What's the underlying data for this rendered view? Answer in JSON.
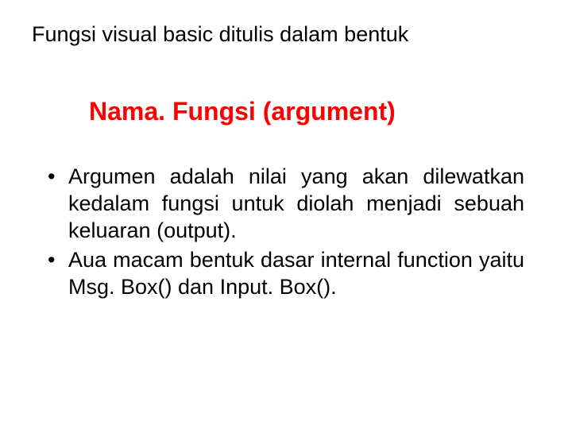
{
  "title": "Fungsi visual basic ditulis dalam bentuk",
  "syntax": "Nama. Fungsi (argument)",
  "bullets": [
    "Argumen adalah nilai yang akan dilewatkan kedalam fungsi untuk diolah menjadi sebuah keluaran (output).",
    "Aua macam bentuk dasar internal function yaitu Msg. Box() dan Input. Box()."
  ],
  "colors": {
    "syntax": "#ff0000",
    "text": "#000000",
    "background": "#ffffff"
  }
}
